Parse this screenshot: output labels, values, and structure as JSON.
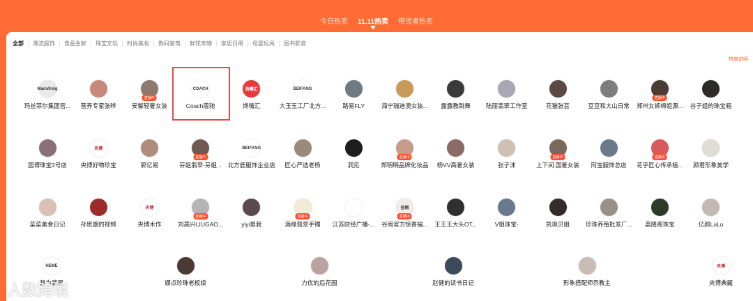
{
  "top_tabs": [
    "今日热卖",
    "11.11热卖",
    "带货者热卖"
  ],
  "categories": [
    "全部",
    "潮流服饰",
    "食品生鲜",
    "珠宝文玩",
    "时尚美妆",
    "数码家电",
    "鲜花宠物",
    "家居日用",
    "母婴玩具",
    "图书影音"
  ],
  "note": "热度说明",
  "live_badge": "直播中",
  "watermark": "人数跨境",
  "colors": {
    "accent": "#ff6b35",
    "highlight": "#e54848"
  },
  "rows": [
    [
      {
        "name": "玛丝菲尔集团官...",
        "badge": false,
        "color": "#e9e9e9",
        "glyph": "Marisfrolg"
      },
      {
        "name": "营养专家张晔",
        "badge": false,
        "color": "#c9897a",
        "glyph": ""
      },
      {
        "name": "安馨轻奢女装",
        "badge": true,
        "color": "#8c7a6f",
        "glyph": ""
      },
      {
        "name": "Coach蔻驰",
        "badge": false,
        "color": "#ffffff",
        "glyph": "COACH"
      },
      {
        "name": "馋嘴汇",
        "badge": false,
        "color": "#e8393b",
        "glyph": "馋嘴汇"
      },
      {
        "name": "大玉玉工厂北方...",
        "badge": false,
        "color": "#ffffff",
        "glyph": "BEIFANG"
      },
      {
        "name": "路易FLY",
        "badge": false,
        "color": "#6f7b82",
        "glyph": ""
      },
      {
        "name": "海宁瑞迪澳女装...",
        "badge": false,
        "color": "#c99a5c",
        "glyph": ""
      },
      {
        "name": "露露教跳舞",
        "badge": false,
        "color": "#3a3a3a",
        "glyph": ""
      },
      {
        "name": "陆丽翡翠工作室",
        "badge": false,
        "color": "#a8a8b5",
        "glyph": ""
      },
      {
        "name": "花猫张芸",
        "badge": false,
        "color": "#5a4a44",
        "glyph": ""
      },
      {
        "name": "豆豆和大山日常",
        "badge": false,
        "color": "#7d7d7d",
        "glyph": ""
      },
      {
        "name": "郑州女裤棉姐源...",
        "badge": true,
        "color": "#4a3b36",
        "glyph": ""
      },
      {
        "name": "谷子姐的珠宝箱",
        "badge": false,
        "color": "#2e2a2a",
        "glyph": ""
      }
    ],
    [
      {
        "name": "园博珠宝2号店",
        "badge": false,
        "color": "#8b6f7a",
        "glyph": ""
      },
      {
        "name": "央博好物珍宝",
        "badge": false,
        "color": "#ffffff",
        "glyph": "央博"
      },
      {
        "name": "郭亿易",
        "badge": false,
        "color": "#b08d7a",
        "glyph": ""
      },
      {
        "name": "芬姐翡翠-芬姐...",
        "badge": true,
        "color": "#6e5a52",
        "glyph": ""
      },
      {
        "name": "北方鹿服饰企业店",
        "badge": false,
        "color": "#ffffff",
        "glyph": "BEIFANG"
      },
      {
        "name": "匠心严选老杨",
        "badge": false,
        "color": "#9a8a7a",
        "glyph": ""
      },
      {
        "name": "洞见",
        "badge": false,
        "color": "#1e1e1e",
        "glyph": ""
      },
      {
        "name": "郑明明品牌化妆品",
        "badge": true,
        "color": "#c59b8a",
        "glyph": ""
      },
      {
        "name": "杨VV高奢女装",
        "badge": false,
        "color": "#8b6b66",
        "glyph": ""
      },
      {
        "name": "张子沫",
        "badge": false,
        "color": "#cfc0b5",
        "glyph": ""
      },
      {
        "name": "上下间.国奢女装",
        "badge": true,
        "color": "#7a6a5e",
        "glyph": ""
      },
      {
        "name": "阿宝服饰总店",
        "badge": false,
        "color": "#6b7a8a",
        "glyph": ""
      },
      {
        "name": "花乎匠心传承植...",
        "badge": true,
        "color": "#d85a5a",
        "glyph": ""
      },
      {
        "name": "颜君形象美学",
        "badge": false,
        "color": "#e0dcd6",
        "glyph": ""
      }
    ],
    [
      {
        "name": "菜菜美食日记",
        "badge": false,
        "color": "#d8c0b5",
        "glyph": ""
      },
      {
        "name": "孙思邈的视频",
        "badge": false,
        "color": "#9e2b2b",
        "glyph": ""
      },
      {
        "name": "央博木作",
        "badge": false,
        "color": "#ffffff",
        "glyph": "央博"
      },
      {
        "name": "刘高兴LIUGAO...",
        "badge": true,
        "color": "#b5b5b5",
        "glyph": ""
      },
      {
        "name": "yiyi是我",
        "badge": false,
        "color": "#5a4a50",
        "glyph": ""
      },
      {
        "name": "满缘翡翠手镯",
        "badge": true,
        "color": "#f3ead8",
        "glyph": ""
      },
      {
        "name": "江苏财经广播-...",
        "badge": false,
        "color": "#ffffff",
        "glyph": ""
      },
      {
        "name": "谷雨官方惊喜福...",
        "badge": true,
        "color": "#f1ece6",
        "glyph": "谷雨"
      },
      {
        "name": "王王王大头OT...",
        "badge": false,
        "color": "#2f2f2f",
        "glyph": ""
      },
      {
        "name": "V姐珠宝-",
        "badge": false,
        "color": "#6a7a8e",
        "glyph": ""
      },
      {
        "name": "凯飒贝姐",
        "badge": false,
        "color": "#332c2a",
        "glyph": ""
      },
      {
        "name": "珍珠养殖批发厂...",
        "badge": false,
        "color": "#9a9089",
        "glyph": ""
      },
      {
        "name": "荔隆阁珠宝",
        "badge": false,
        "color": "#2d3a2a",
        "glyph": ""
      },
      {
        "name": "亿颜LuLu",
        "badge": false,
        "color": "#c4b8b2",
        "glyph": ""
      }
    ],
    [
      {
        "name": "慧为翡翠",
        "badge": false,
        "color": "#ffffff",
        "glyph": "HEME"
      },
      {
        "name": "娜点珍珠老板娘",
        "badge": false,
        "color": "#4a3a36",
        "glyph": ""
      },
      {
        "name": "力优的后花园",
        "badge": false,
        "color": "#b8a3a0",
        "glyph": ""
      },
      {
        "name": "赵健的读书日记",
        "badge": false,
        "color": "#3c4a5a",
        "glyph": ""
      },
      {
        "name": "形象搭配师乔教主",
        "badge": false,
        "color": "#c8bcb5",
        "glyph": ""
      },
      {
        "name": "央博典藏",
        "badge": false,
        "color": "#ffffff",
        "glyph": "央博"
      }
    ]
  ]
}
